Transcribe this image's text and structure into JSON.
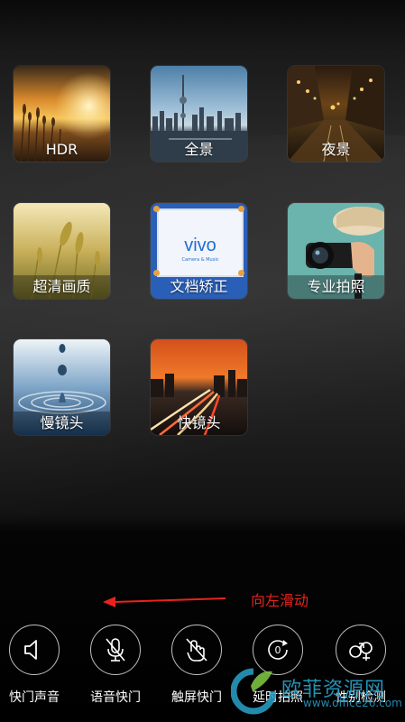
{
  "modes": [
    {
      "label": "HDR"
    },
    {
      "label": "全景"
    },
    {
      "label": "夜景"
    },
    {
      "label": "超清画质"
    },
    {
      "label": "文档矫正",
      "art_text": "vivo",
      "art_subtext": "Camera & Music"
    },
    {
      "label": "专业拍照"
    },
    {
      "label": "慢镜头"
    },
    {
      "label": "快镜头"
    }
  ],
  "hint": {
    "text": "向左滑动",
    "color": "#e8231c"
  },
  "toolbar": [
    {
      "label": "快门声音",
      "icon": "speaker-icon"
    },
    {
      "label": "语音快门",
      "icon": "microphone-muted-icon"
    },
    {
      "label": "触屏快门",
      "icon": "touch-muted-icon"
    },
    {
      "label": "延时拍照",
      "icon": "timer-icon"
    },
    {
      "label": "性别检测",
      "icon": "gender-icon"
    }
  ],
  "watermark": {
    "name": "欧菲资源网",
    "url": "www.office26.com",
    "color": "#2aa2c9"
  }
}
